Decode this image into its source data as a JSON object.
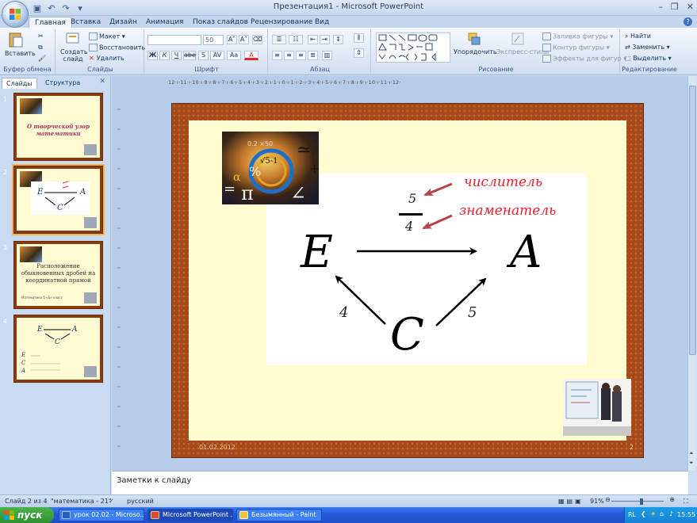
{
  "window": {
    "title": "Презентация1 - Microsoft PowerPoint"
  },
  "ribbon_tabs": [
    "Главная",
    "Вставка",
    "Дизайн",
    "Анимация",
    "Показ слайдов",
    "Рецензирование",
    "Вид"
  ],
  "ribbon": {
    "clipboard": {
      "paste": "Вставить",
      "label": "Буфер обмена"
    },
    "slides": {
      "create": "Создать",
      "slide": "слайд",
      "layout": "Макет",
      "reset": "Восстановить",
      "delete": "Удалить",
      "label": "Слайды"
    },
    "font": {
      "size": "50",
      "label": "Шрифт",
      "b": "Ж",
      "i": "К",
      "u": "Ч",
      "s": "abe",
      "sh": "S",
      "sp": "AV",
      "case": "Aa",
      "color": "A"
    },
    "paragraph": {
      "label": "Абзац"
    },
    "drawing": {
      "arrange": "Упорядочить",
      "styles": "Экспресс-стили",
      "fill": "Заливка фигуры",
      "outline": "Контур фигуры",
      "effects": "Эффекты для фигур",
      "label": "Рисование"
    },
    "editing": {
      "find": "Найти",
      "replace": "Заменить",
      "select": "Выделить",
      "label": "Редактирование"
    }
  },
  "leftpane": {
    "tab_slides": "Слайды",
    "tab_outline": "Структура",
    "thumbs": [
      {
        "num": "1",
        "title": "О творческой узор математики"
      },
      {
        "num": "2",
        "title": ""
      },
      {
        "num": "3",
        "title": "Расположение обыкновенных дробей на координатной прямой",
        "sub": "Математика 5 «Б» класс"
      },
      {
        "num": "4",
        "title": ""
      }
    ]
  },
  "ruler": {
    "h": "·12·ı·11·ı·10·ı·9·ı·8·ı·7·ı·6·ı·5·ı·4·ı·3·ı·2·ı·1·ı·0·ı·1·ı·2·ı·3·ı·4·ı·5·ı·6·ı·7·ı·8·ı·9·ı·10·ı·11·ı·12·"
  },
  "slide": {
    "label_numerator": "числитель",
    "label_denominator": "знаменатель",
    "frac_num": "5",
    "frac_den": "4",
    "E": "E",
    "A": "A",
    "C": "C",
    "w_ce": "4",
    "w_ca": "5",
    "date": "01.02.2012",
    "page_num": "2"
  },
  "notes": {
    "placeholder": "Заметки к слайду"
  },
  "status": {
    "slide_info": "Слайд 2 из 4",
    "theme": "\"математика - 21\"",
    "lang": "русский",
    "zoom": "91%"
  },
  "taskbar": {
    "start": "пуск",
    "tasks": [
      "урок 02.02 - Microso...",
      "Microsoft PowerPoint ...",
      "Безымянный - Paint"
    ],
    "lang": "RL",
    "clock": "15:55"
  },
  "colors": {
    "slide_border": "#a44a1b",
    "slide_bg": "#fffcd0",
    "label_red": "#e8212a"
  }
}
